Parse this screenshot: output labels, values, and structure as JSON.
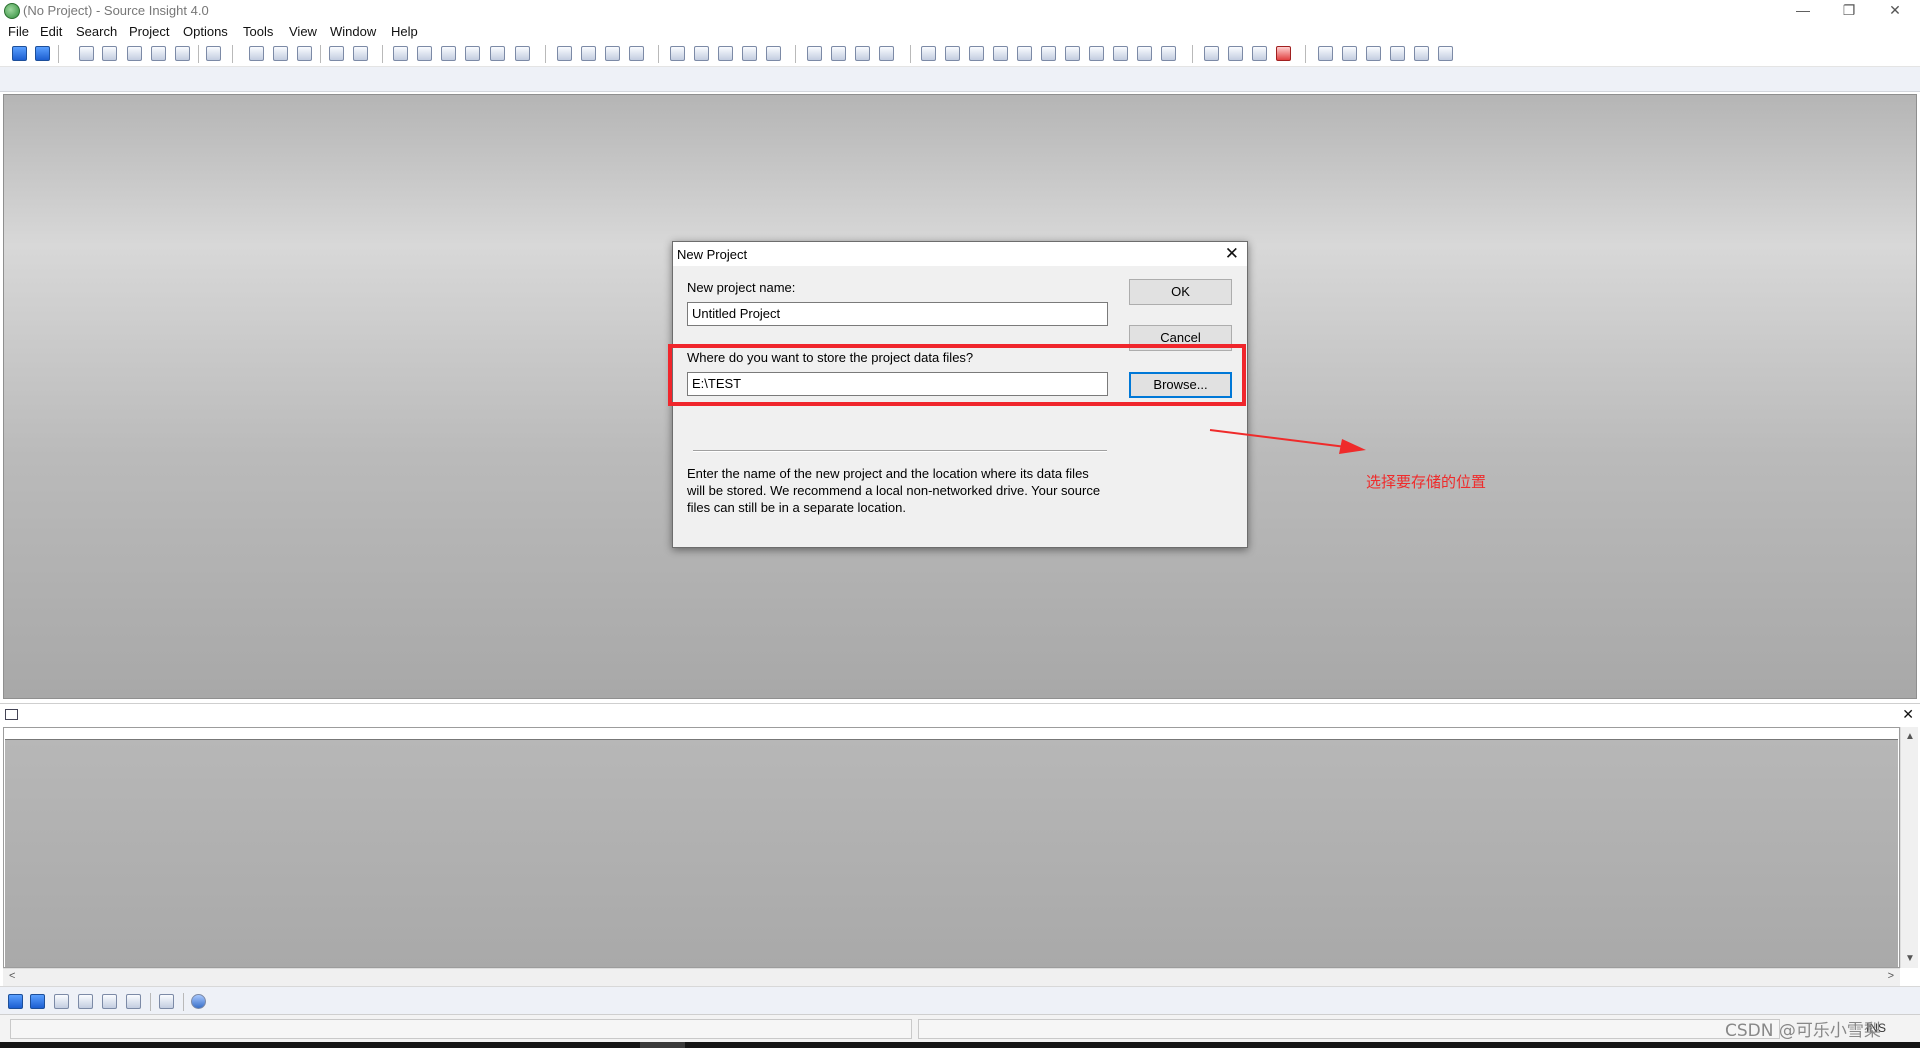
{
  "window": {
    "title": "(No Project) - Source Insight 4.0",
    "controls": {
      "minimize": "—",
      "restore": "❐",
      "close": "✕"
    }
  },
  "menubar": {
    "items": [
      "File",
      "Edit",
      "Search",
      "Project",
      "Options",
      "Tools",
      "View",
      "Window",
      "Help"
    ]
  },
  "dialog": {
    "title": "New Project",
    "close_glyph": "✕",
    "name_label": "New project name:",
    "name_value": "Untitled Project",
    "location_label": "Where do you want to store the project data files?",
    "location_value": "E:\\TEST",
    "ok_label": "OK",
    "cancel_label": "Cancel",
    "browse_label": "Browse...",
    "help_text": "Enter the name of the new project and the location where its data files will be stored. We recommend a local non-networked drive. Your source files can still be in a separate location."
  },
  "annotation": {
    "text": "选择要存储的位置",
    "color": "#ef2b2b"
  },
  "bottom_panel": {
    "close_glyph": "✕",
    "scroll_up": "▲",
    "scroll_down": "▼",
    "scroll_left": "<",
    "scroll_right": ">"
  },
  "status_bar": {
    "ins_indicator": "INS"
  },
  "watermark": "CSDN @可乐小雪梨"
}
